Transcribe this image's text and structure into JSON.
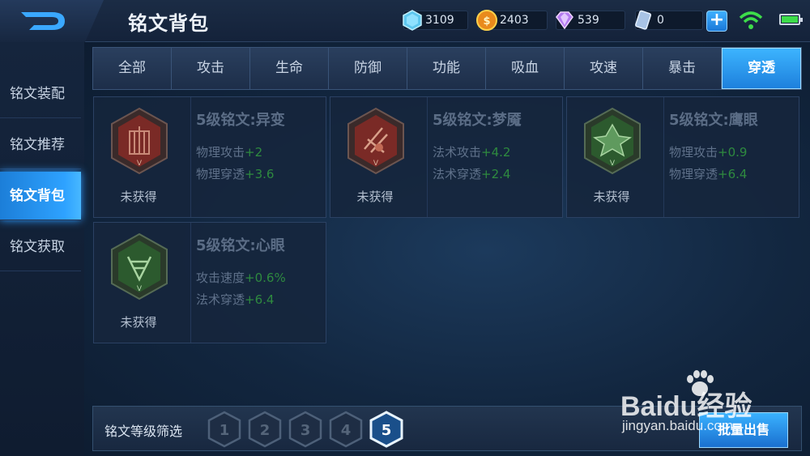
{
  "header": {
    "title": "铭文背包",
    "resources": [
      {
        "icon": "diamond-icon",
        "value": "3109"
      },
      {
        "icon": "gold-coin-icon",
        "value": "2403"
      },
      {
        "icon": "gem-icon",
        "value": "539"
      },
      {
        "icon": "voucher-icon",
        "value": "0"
      }
    ],
    "add_label": "+"
  },
  "sidebar": {
    "items": [
      {
        "label": "铭文装配"
      },
      {
        "label": "铭文推荐"
      },
      {
        "label": "铭文背包",
        "active": true
      },
      {
        "label": "铭文获取"
      }
    ]
  },
  "tabs": [
    {
      "label": "全部"
    },
    {
      "label": "攻击"
    },
    {
      "label": "生命"
    },
    {
      "label": "防御"
    },
    {
      "label": "功能"
    },
    {
      "label": "吸血"
    },
    {
      "label": "攻速"
    },
    {
      "label": "暴击"
    },
    {
      "label": "穿透",
      "active": true
    }
  ],
  "cards": [
    {
      "name": "5级铭文:异变",
      "status": "未获得",
      "color": "#7a2a26",
      "stats": [
        {
          "label": "物理攻击",
          "value": "+2"
        },
        {
          "label": "物理穿透",
          "value": "+3.6"
        }
      ]
    },
    {
      "name": "5级铭文:梦魇",
      "status": "未获得",
      "color": "#7a2a26",
      "stats": [
        {
          "label": "法术攻击",
          "value": "+4.2"
        },
        {
          "label": "法术穿透",
          "value": "+2.4"
        }
      ]
    },
    {
      "name": "5级铭文:鹰眼",
      "status": "未获得",
      "color": "#2c5a2e",
      "stats": [
        {
          "label": "物理攻击",
          "value": "+0.9"
        },
        {
          "label": "物理穿透",
          "value": "+6.4"
        }
      ]
    },
    {
      "name": "5级铭文:心眼",
      "status": "未获得",
      "color": "#2c5a2e",
      "stats": [
        {
          "label": "攻击速度",
          "value": "+0.6%"
        },
        {
          "label": "法术穿透",
          "value": "+6.4"
        }
      ]
    }
  ],
  "bottom": {
    "filter_label": "铭文等级筛选",
    "levels": [
      "1",
      "2",
      "3",
      "4",
      "5"
    ],
    "selected_level": "5",
    "bulk_sell_label": "批量出售"
  },
  "watermark": {
    "brand": "Baidu经验",
    "url": "jingyan.baidu.com"
  },
  "colors": {
    "accent": "#2ea2ff",
    "stat_value": "#2e8a3f",
    "wifi": "#3ddc4a"
  }
}
